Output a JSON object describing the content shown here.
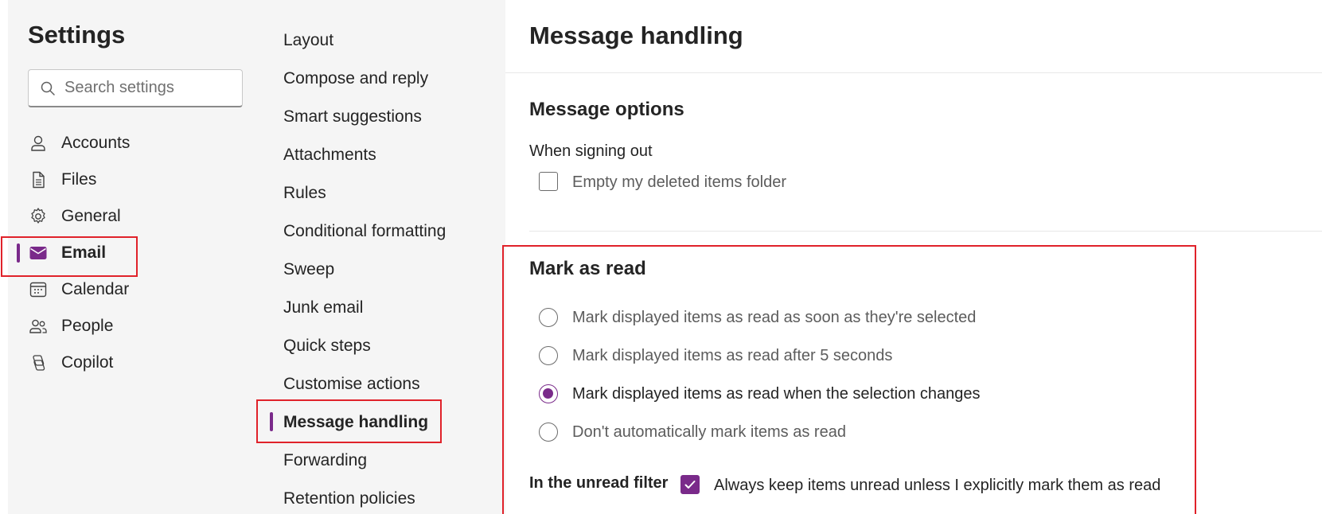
{
  "sidebar": {
    "title": "Settings",
    "search_placeholder": "Search settings",
    "items": [
      {
        "label": "Accounts",
        "icon": "person-icon"
      },
      {
        "label": "Files",
        "icon": "file-icon"
      },
      {
        "label": "General",
        "icon": "gear-icon"
      },
      {
        "label": "Email",
        "icon": "mail-icon",
        "active": true
      },
      {
        "label": "Calendar",
        "icon": "calendar-icon"
      },
      {
        "label": "People",
        "icon": "people-icon"
      },
      {
        "label": "Copilot",
        "icon": "copilot-icon"
      }
    ]
  },
  "submenu": {
    "items": [
      {
        "label": "Layout"
      },
      {
        "label": "Compose and reply"
      },
      {
        "label": "Smart suggestions"
      },
      {
        "label": "Attachments"
      },
      {
        "label": "Rules"
      },
      {
        "label": "Conditional formatting"
      },
      {
        "label": "Sweep"
      },
      {
        "label": "Junk email"
      },
      {
        "label": "Quick steps"
      },
      {
        "label": "Customise actions"
      },
      {
        "label": "Message handling",
        "active": true
      },
      {
        "label": "Forwarding"
      },
      {
        "label": "Retention policies"
      }
    ]
  },
  "main": {
    "title": "Message handling",
    "message_options": {
      "title": "Message options",
      "signing_out_label": "When signing out",
      "empty_deleted_label": "Empty my deleted items folder",
      "empty_deleted_checked": false
    },
    "mark_as_read": {
      "title": "Mark as read",
      "options": [
        {
          "label": "Mark displayed items as read as soon as they're selected",
          "checked": false
        },
        {
          "label": "Mark displayed items as read after 5 seconds",
          "checked": false
        },
        {
          "label": "Mark displayed items as read when the selection changes",
          "checked": true
        },
        {
          "label": "Don't automatically mark items as read",
          "checked": false
        }
      ],
      "unread_filter_label": "In the unread filter",
      "keep_unread_label": "Always keep items unread unless I explicitly mark them as read",
      "keep_unread_checked": true
    }
  },
  "colors": {
    "accent": "#7a2a8a",
    "highlight": "#e0222a",
    "pane_bg": "#f5f5f5"
  }
}
